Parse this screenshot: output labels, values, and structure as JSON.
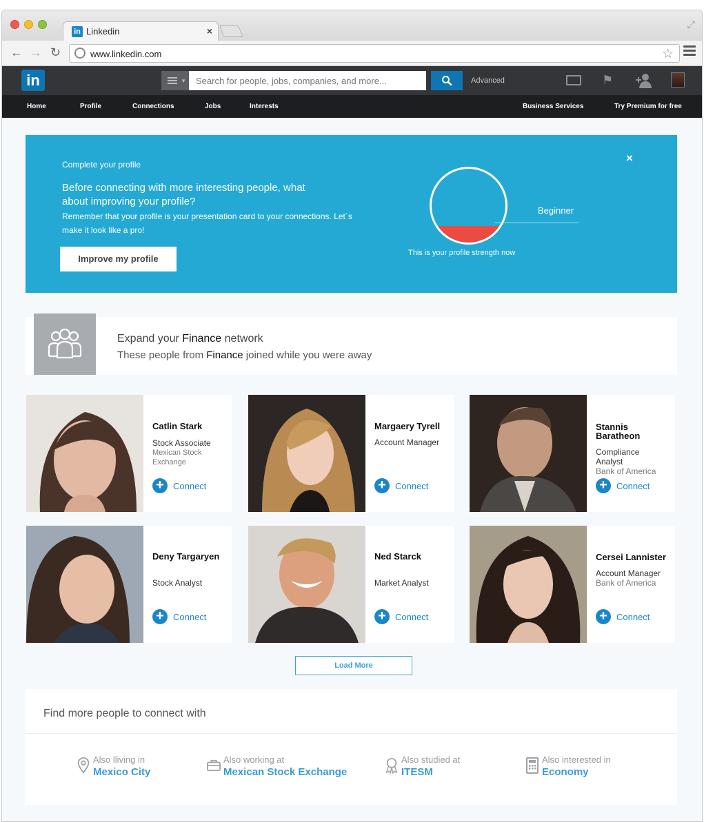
{
  "browser": {
    "tab_title": "Linkedin",
    "tab_favicon": "in",
    "tab_close": "×",
    "url": "www.linkedin.com"
  },
  "header": {
    "logo": "in",
    "search_placeholder": "Search for people, jobs, companies, and more...",
    "advanced_label": "Advanced",
    "icons": [
      "mail-icon",
      "flag-icon",
      "add-connection-icon",
      "avatar"
    ]
  },
  "nav": {
    "items": [
      "Home",
      "Profile",
      "Connections",
      "Jobs",
      "Interests"
    ],
    "right_items": [
      "Business Services",
      "Try Premium for free"
    ]
  },
  "banner": {
    "kicker": "Complete your profile",
    "headline": "Before connecting with more interesting people, what about improving your profile?",
    "body": "Remember that your profile is your presentation card to your connections. Let´s make it look like a pro!",
    "button_label": "Improve my profile",
    "close": "×",
    "strength_level": "Beginner",
    "strength_caption": "This is your profile strength now",
    "strength_fraction": 0.22,
    "colors": {
      "background": "#24a9d4",
      "gauge_fill": "#ea4b43"
    }
  },
  "expand": {
    "title_pre": "Expand your ",
    "title_highlight": "Finance",
    "title_post": " network",
    "sub_pre": "These people from ",
    "sub_highlight": "Finance",
    "sub_post": " joined while you were away"
  },
  "people": [
    {
      "name": "Catlin Stark",
      "role": "Stock Associate",
      "company": "Mexican Stock Exchange",
      "connect": "Connect"
    },
    {
      "name": "Margaery Tyrell",
      "role": "Account Manager",
      "company": "",
      "connect": "Connect"
    },
    {
      "name": "Stannis Baratheon",
      "role": "Compliance Analyst",
      "company": "Bank of America",
      "connect": "Connect"
    },
    {
      "name": "Deny Targaryen",
      "role": "Stock Analyst",
      "company": "",
      "connect": "Connect"
    },
    {
      "name": "Ned Starck",
      "role": "Market Analyst",
      "company": "",
      "connect": "Connect"
    },
    {
      "name": "Cersei Lannister",
      "role": "Account Manager",
      "company": "Bank of America",
      "connect": "Connect"
    }
  ],
  "load_more": "Load More",
  "find_more": {
    "title": "Find more people to connect with",
    "items": [
      {
        "pre": "Also lliving in",
        "value": "Mexico City",
        "icon": "location-pin-icon"
      },
      {
        "pre": "Also working at",
        "value": "Mexican Stock Exchange",
        "icon": "briefcase-icon"
      },
      {
        "pre": "Also studied at",
        "value": "ITESM",
        "icon": "ribbon-icon"
      },
      {
        "pre": "Also interested in",
        "value": "Economy",
        "icon": "calculator-icon"
      }
    ]
  },
  "colors": {
    "accent": "#1b86c6",
    "brand": "#0e76b4",
    "header": "#333538",
    "nav": "#1d1e20"
  }
}
